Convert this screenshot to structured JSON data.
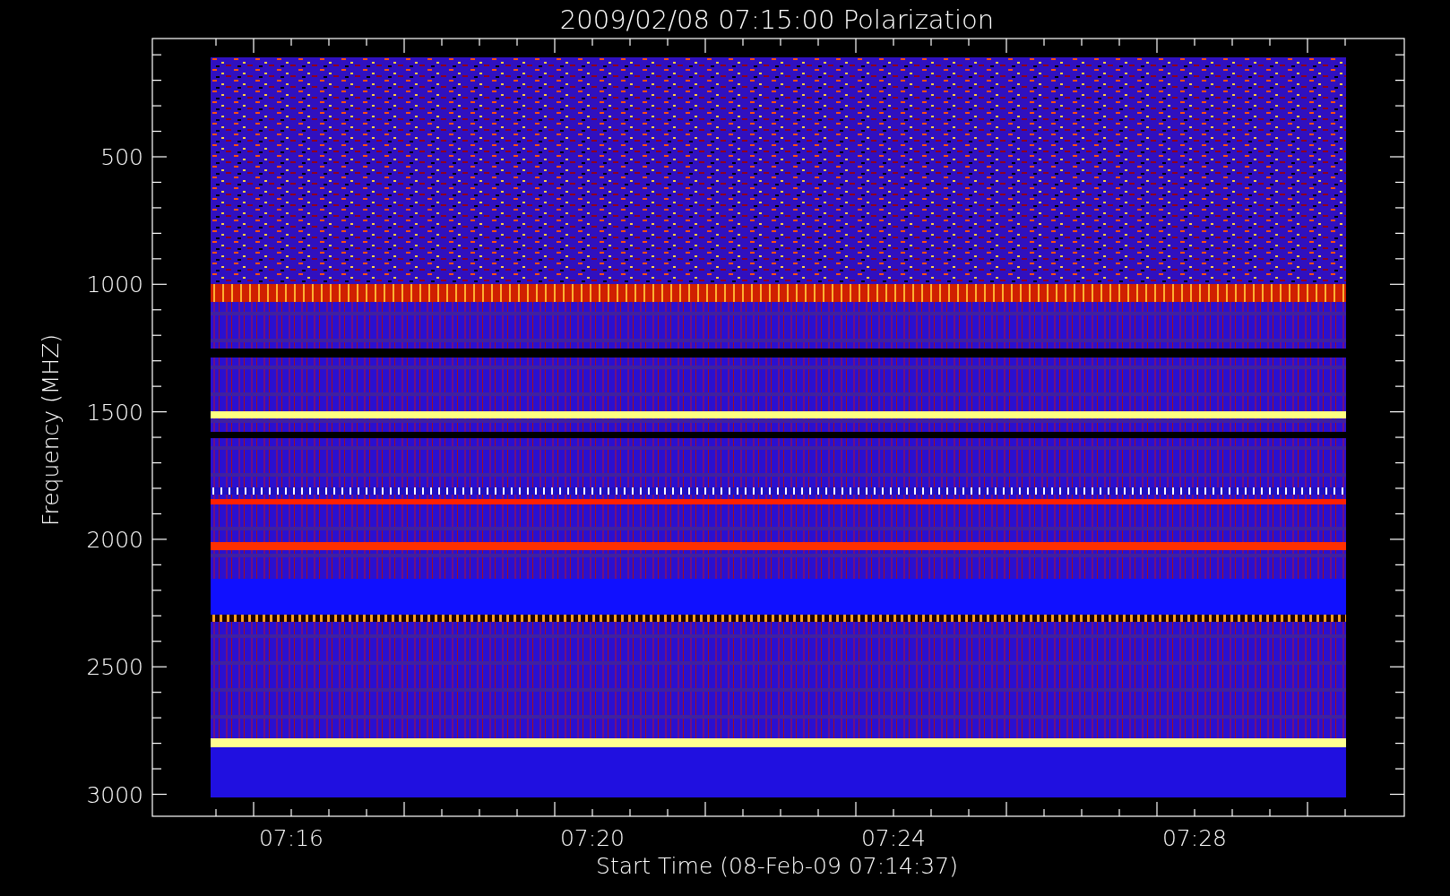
{
  "title": "2009/02/08 07:15:00 Polarization",
  "y_axis": {
    "label": "Frequency (MHZ)",
    "ticks": [
      "500",
      "1000",
      "1500",
      "2000",
      "2500",
      "3000"
    ]
  },
  "x_axis": {
    "label": "Start Time (08-Feb-09 07:14:37)",
    "ticks": [
      "07:16",
      "07:20",
      "07:24",
      "07:28"
    ]
  }
}
